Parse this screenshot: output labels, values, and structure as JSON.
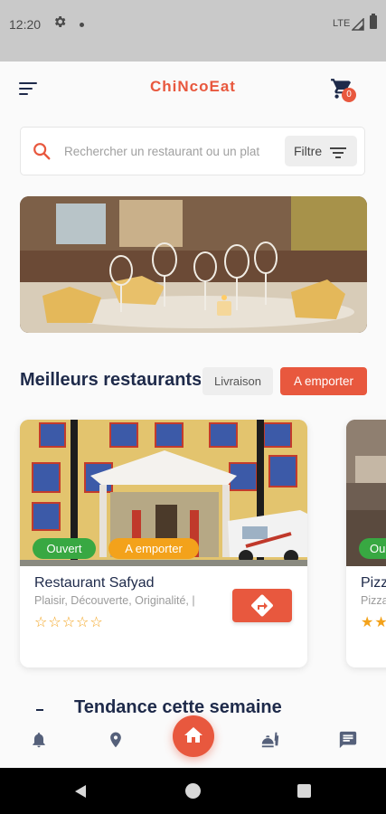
{
  "status_bar": {
    "time": "12:20",
    "network": "LTE"
  },
  "header": {
    "title": "ChiNcoEat",
    "cart_count": "0"
  },
  "search": {
    "placeholder": "Rechercher un restaurant ou un plat",
    "filter_label": "Filtre"
  },
  "best_restaurants": {
    "title": "Meilleurs restaurants",
    "chips": [
      "Livraison",
      "A emporter"
    ],
    "cards": [
      {
        "status": "Ouvert",
        "mode": "A emporter",
        "name": "Restaurant Safyad",
        "description": "Plaisir, Découverte, Originalité, |",
        "rating_stars": "☆☆☆☆☆"
      },
      {
        "status": "Ou",
        "name": "Pizz",
        "description": "Pizza",
        "rating_stars": "★★"
      }
    ]
  },
  "trending": {
    "title": "Tendance cette semaine"
  },
  "colors": {
    "accent": "#e8583e",
    "navy": "#1e2a4a",
    "open": "#38a842",
    "takeaway": "#f3a21b"
  },
  "bottom_nav": [
    "bell-icon",
    "location-icon",
    "home-icon",
    "food-icon",
    "chat-icon"
  ]
}
